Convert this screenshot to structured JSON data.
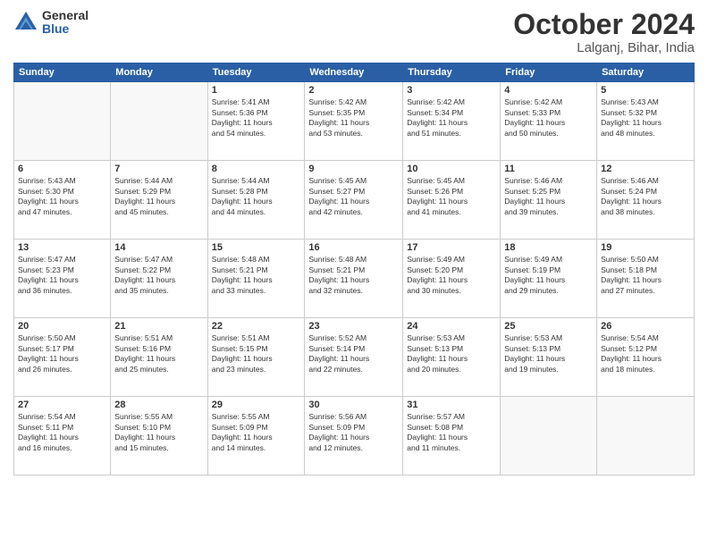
{
  "header": {
    "logo_general": "General",
    "logo_blue": "Blue",
    "month": "October 2024",
    "location": "Lalganj, Bihar, India"
  },
  "weekdays": [
    "Sunday",
    "Monday",
    "Tuesday",
    "Wednesday",
    "Thursday",
    "Friday",
    "Saturday"
  ],
  "weeks": [
    [
      {
        "day": "",
        "info": ""
      },
      {
        "day": "",
        "info": ""
      },
      {
        "day": "1",
        "info": "Sunrise: 5:41 AM\nSunset: 5:36 PM\nDaylight: 11 hours\nand 54 minutes."
      },
      {
        "day": "2",
        "info": "Sunrise: 5:42 AM\nSunset: 5:35 PM\nDaylight: 11 hours\nand 53 minutes."
      },
      {
        "day": "3",
        "info": "Sunrise: 5:42 AM\nSunset: 5:34 PM\nDaylight: 11 hours\nand 51 minutes."
      },
      {
        "day": "4",
        "info": "Sunrise: 5:42 AM\nSunset: 5:33 PM\nDaylight: 11 hours\nand 50 minutes."
      },
      {
        "day": "5",
        "info": "Sunrise: 5:43 AM\nSunset: 5:32 PM\nDaylight: 11 hours\nand 48 minutes."
      }
    ],
    [
      {
        "day": "6",
        "info": "Sunrise: 5:43 AM\nSunset: 5:30 PM\nDaylight: 11 hours\nand 47 minutes."
      },
      {
        "day": "7",
        "info": "Sunrise: 5:44 AM\nSunset: 5:29 PM\nDaylight: 11 hours\nand 45 minutes."
      },
      {
        "day": "8",
        "info": "Sunrise: 5:44 AM\nSunset: 5:28 PM\nDaylight: 11 hours\nand 44 minutes."
      },
      {
        "day": "9",
        "info": "Sunrise: 5:45 AM\nSunset: 5:27 PM\nDaylight: 11 hours\nand 42 minutes."
      },
      {
        "day": "10",
        "info": "Sunrise: 5:45 AM\nSunset: 5:26 PM\nDaylight: 11 hours\nand 41 minutes."
      },
      {
        "day": "11",
        "info": "Sunrise: 5:46 AM\nSunset: 5:25 PM\nDaylight: 11 hours\nand 39 minutes."
      },
      {
        "day": "12",
        "info": "Sunrise: 5:46 AM\nSunset: 5:24 PM\nDaylight: 11 hours\nand 38 minutes."
      }
    ],
    [
      {
        "day": "13",
        "info": "Sunrise: 5:47 AM\nSunset: 5:23 PM\nDaylight: 11 hours\nand 36 minutes."
      },
      {
        "day": "14",
        "info": "Sunrise: 5:47 AM\nSunset: 5:22 PM\nDaylight: 11 hours\nand 35 minutes."
      },
      {
        "day": "15",
        "info": "Sunrise: 5:48 AM\nSunset: 5:21 PM\nDaylight: 11 hours\nand 33 minutes."
      },
      {
        "day": "16",
        "info": "Sunrise: 5:48 AM\nSunset: 5:21 PM\nDaylight: 11 hours\nand 32 minutes."
      },
      {
        "day": "17",
        "info": "Sunrise: 5:49 AM\nSunset: 5:20 PM\nDaylight: 11 hours\nand 30 minutes."
      },
      {
        "day": "18",
        "info": "Sunrise: 5:49 AM\nSunset: 5:19 PM\nDaylight: 11 hours\nand 29 minutes."
      },
      {
        "day": "19",
        "info": "Sunrise: 5:50 AM\nSunset: 5:18 PM\nDaylight: 11 hours\nand 27 minutes."
      }
    ],
    [
      {
        "day": "20",
        "info": "Sunrise: 5:50 AM\nSunset: 5:17 PM\nDaylight: 11 hours\nand 26 minutes."
      },
      {
        "day": "21",
        "info": "Sunrise: 5:51 AM\nSunset: 5:16 PM\nDaylight: 11 hours\nand 25 minutes."
      },
      {
        "day": "22",
        "info": "Sunrise: 5:51 AM\nSunset: 5:15 PM\nDaylight: 11 hours\nand 23 minutes."
      },
      {
        "day": "23",
        "info": "Sunrise: 5:52 AM\nSunset: 5:14 PM\nDaylight: 11 hours\nand 22 minutes."
      },
      {
        "day": "24",
        "info": "Sunrise: 5:53 AM\nSunset: 5:13 PM\nDaylight: 11 hours\nand 20 minutes."
      },
      {
        "day": "25",
        "info": "Sunrise: 5:53 AM\nSunset: 5:13 PM\nDaylight: 11 hours\nand 19 minutes."
      },
      {
        "day": "26",
        "info": "Sunrise: 5:54 AM\nSunset: 5:12 PM\nDaylight: 11 hours\nand 18 minutes."
      }
    ],
    [
      {
        "day": "27",
        "info": "Sunrise: 5:54 AM\nSunset: 5:11 PM\nDaylight: 11 hours\nand 16 minutes."
      },
      {
        "day": "28",
        "info": "Sunrise: 5:55 AM\nSunset: 5:10 PM\nDaylight: 11 hours\nand 15 minutes."
      },
      {
        "day": "29",
        "info": "Sunrise: 5:55 AM\nSunset: 5:09 PM\nDaylight: 11 hours\nand 14 minutes."
      },
      {
        "day": "30",
        "info": "Sunrise: 5:56 AM\nSunset: 5:09 PM\nDaylight: 11 hours\nand 12 minutes."
      },
      {
        "day": "31",
        "info": "Sunrise: 5:57 AM\nSunset: 5:08 PM\nDaylight: 11 hours\nand 11 minutes."
      },
      {
        "day": "",
        "info": ""
      },
      {
        "day": "",
        "info": ""
      }
    ]
  ]
}
